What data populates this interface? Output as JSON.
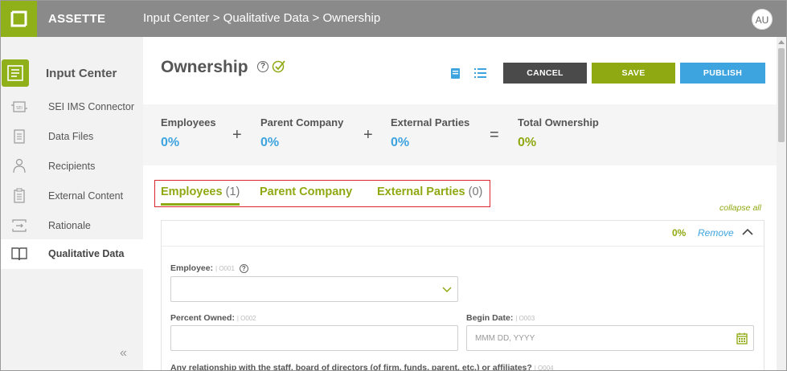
{
  "app": {
    "brand": "ASSETTE",
    "avatar_initials": "AU"
  },
  "breadcrumb": {
    "text": "Input Center > Qualitative Data > Ownership"
  },
  "sidebar": {
    "header": "Input Center",
    "items": [
      {
        "label": "SEI IMS Connector",
        "icon": "connector-icon"
      },
      {
        "label": "Data Files",
        "icon": "data-files-icon"
      },
      {
        "label": "Recipients",
        "icon": "recipients-icon"
      },
      {
        "label": "External Content",
        "icon": "external-content-icon"
      },
      {
        "label": "Rationale",
        "icon": "rationale-icon"
      },
      {
        "label": "Qualitative Data",
        "icon": "book-icon",
        "active": true
      }
    ],
    "collapse_glyph": "«"
  },
  "page": {
    "title": "Ownership",
    "help_glyph": "?",
    "buttons": {
      "cancel": "CANCEL",
      "save": "SAVE",
      "publish": "PUBLISH"
    }
  },
  "summary": {
    "employees": {
      "label": "Employees",
      "value": "0%"
    },
    "parent": {
      "label": "Parent Company",
      "value": "0%"
    },
    "external": {
      "label": "External Parties",
      "value": "0%"
    },
    "total": {
      "label": "Total Ownership",
      "value": "0%"
    },
    "plus": "+",
    "equals": "="
  },
  "tabs": [
    {
      "label": "Employees",
      "count": "(1)"
    },
    {
      "label": "Parent Company",
      "count": ""
    },
    {
      "label": "External Parties",
      "count": "(0)"
    }
  ],
  "collapse_all": "collapse all",
  "panel": {
    "percent": "0%",
    "remove": "Remove",
    "employee_label": "Employee:",
    "employee_code": "| O001",
    "percent_label": "Percent Owned:",
    "percent_code": "| O002",
    "begin_label": "Begin Date:",
    "begin_code": "| O003",
    "begin_placeholder": "MMM DD, YYYY",
    "relationship_label": "Any relationship with the staff, board of directors (of firm, funds, parent, etc.) or affiliates?",
    "relationship_code": "| O004"
  },
  "colors": {
    "accent_green": "#8fa913",
    "accent_blue": "#3ea4e0",
    "topbar": "#8a8a8a",
    "highlight_red": "#d9262c"
  }
}
